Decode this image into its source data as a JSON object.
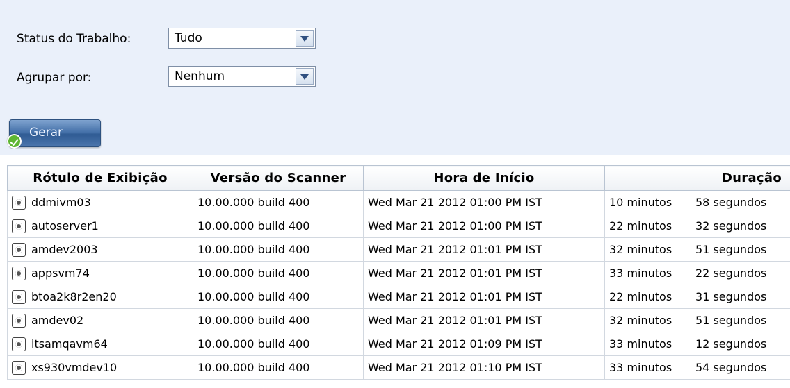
{
  "filters": {
    "status_label": "Status do Trabalho:",
    "status_value": "Tudo",
    "group_label": "Agrupar por:",
    "group_value": "Nenhum",
    "generate_label": "Gerar"
  },
  "table": {
    "headers": [
      "Rótulo de Exibição",
      "Versão do Scanner",
      "Hora de Início",
      "Duração"
    ],
    "rows": [
      {
        "label": "ddmivm03",
        "version": "10.00.000 build 400",
        "start": "Wed Mar 21 2012 01:00 PM IST",
        "minutes": "10 minutos",
        "seconds": "58 segundos"
      },
      {
        "label": "autoserver1",
        "version": "10.00.000 build 400",
        "start": "Wed Mar 21 2012 01:00 PM IST",
        "minutes": "22 minutos",
        "seconds": "32 segundos"
      },
      {
        "label": "amdev2003",
        "version": "10.00.000 build 400",
        "start": "Wed Mar 21 2012 01:01 PM IST",
        "minutes": "32 minutos",
        "seconds": "51 segundos"
      },
      {
        "label": "appsvm74",
        "version": "10.00.000 build 400",
        "start": "Wed Mar 21 2012 01:01 PM IST",
        "minutes": "33 minutos",
        "seconds": "22 segundos"
      },
      {
        "label": "btoa2k8r2en20",
        "version": "10.00.000 build 400",
        "start": "Wed Mar 21 2012 01:01 PM IST",
        "minutes": "22 minutos",
        "seconds": "31 segundos"
      },
      {
        "label": "amdev02",
        "version": "10.00.000 build 400",
        "start": "Wed Mar 21 2012 01:01 PM IST",
        "minutes": "32 minutos",
        "seconds": "51 segundos"
      },
      {
        "label": "itsamqavm64",
        "version": "10.00.000 build 400",
        "start": "Wed Mar 21 2012 01:09 PM IST",
        "minutes": "33 minutos",
        "seconds": "12 segundos"
      },
      {
        "label": "xs930vmdev10",
        "version": "10.00.000 build 400",
        "start": "Wed Mar 21 2012 01:10 PM IST",
        "minutes": "33 minutos",
        "seconds": "54 segundos"
      }
    ]
  }
}
